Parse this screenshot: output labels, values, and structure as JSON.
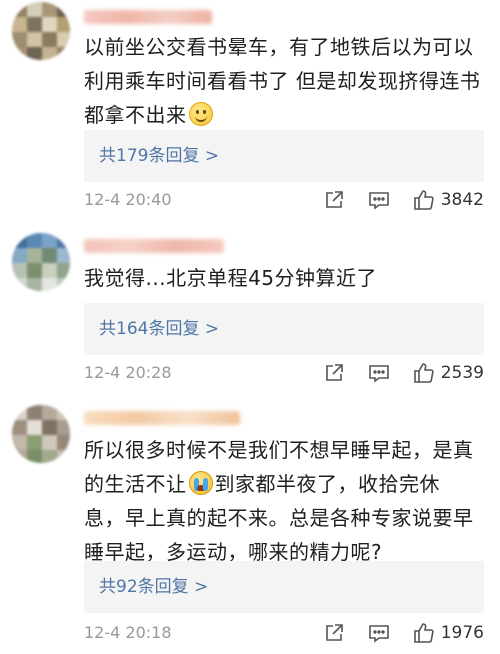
{
  "comments": [
    {
      "text_lines": [
        "以前坐公交看书晕车，有了地铁后以为可以",
        "利用乘车时间看看书了 但是却发现挤得连书",
        "都拿不出来"
      ],
      "emoji_after_line": 2,
      "emoji": "smile-emoji",
      "replies": "共179条回复 >",
      "time": "12-4 20:40",
      "likes": "3842"
    },
    {
      "text_lines": [
        "我觉得...北京单程45分钟算近了"
      ],
      "replies": "共164条回复 >",
      "time": "12-4 20:28",
      "likes": "2539"
    },
    {
      "text_lines": [
        "所以很多时候不是我们不想早睡早起，是真",
        "的生活不让",
        "到家都半夜了，收拾完休",
        "息，早上真的起不来。总是各种专家说要早",
        "睡早起，多运动，哪来的精力呢?"
      ],
      "emoji": "crying-emoji",
      "replies": "共92条回复 >",
      "time": "12-4 20:18",
      "likes": "1976"
    }
  ],
  "icons": {
    "share": "share-icon",
    "comment": "comment-icon",
    "like": "like-icon"
  }
}
